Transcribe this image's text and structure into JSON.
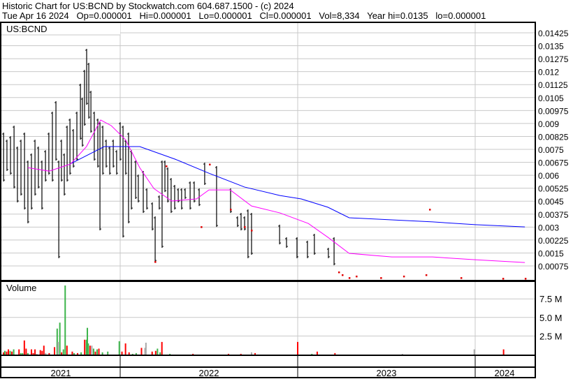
{
  "header": {
    "line1": "Historic Chart for US:BCND by Stockwatch.com 604.687.1500 - (c) 2024",
    "line2": "Tue Apr 16 2024   Op=0.000001   Hi=0.000001   Lo=0.000001   Cl=0.000001   Vol=8,334   Year hi=0.0135   lo=0.000001"
  },
  "chart_data": [
    {
      "type": "line",
      "title": "US:BCND",
      "x_unit": "year",
      "xlim": [
        2021.33,
        2024.335
      ],
      "ylim": [
        0,
        0.0148
      ],
      "yticks": [
        "0.01425",
        "0.0135",
        "0.01275",
        "0.012",
        "0.01125",
        "0.0105",
        "0.00975",
        "0.009",
        "0.00825",
        "0.0075",
        "0.00675",
        "0.006",
        "0.00525",
        "0.0045",
        "0.00375",
        "0.003",
        "0.00225",
        "0.0015",
        "0.00075"
      ],
      "price_bars_hi_lo": [
        [
          2021.343,
          0.00847,
          0.00564
        ],
        [
          2021.362,
          0.00806,
          0.00625
        ],
        [
          2021.382,
          0.00826,
          0.00604
        ],
        [
          2021.402,
          0.00887,
          0.00524
        ],
        [
          2021.421,
          0.00766,
          0.00443
        ],
        [
          2021.441,
          0.00806,
          0.00483
        ],
        [
          2021.461,
          0.00847,
          0.00402
        ],
        [
          2021.48,
          0.00685,
          0.00322
        ],
        [
          2021.5,
          0.00726,
          0.00402
        ],
        [
          2021.52,
          0.00806,
          0.00483
        ],
        [
          2021.539,
          0.00766,
          0.00524
        ],
        [
          2021.559,
          0.00685,
          0.00402
        ],
        [
          2021.579,
          0.00745,
          0.00564
        ],
        [
          2021.598,
          0.00847,
          0.00604
        ],
        [
          2021.618,
          0.00968,
          0.00564
        ],
        [
          2021.638,
          0.01029,
          0.00685
        ],
        [
          2021.654,
          0.00685,
          0.0012
        ],
        [
          2021.669,
          0.00806,
          0.00564
        ],
        [
          2021.685,
          0.00726,
          0.00483
        ],
        [
          2021.701,
          0.00887,
          0.00564
        ],
        [
          2021.717,
          0.00928,
          0.00604
        ],
        [
          2021.736,
          0.00867,
          0.00645
        ],
        [
          2021.756,
          0.00968,
          0.00685
        ],
        [
          2021.776,
          0.0113,
          0.00806
        ],
        [
          2021.787,
          0.01049,
          0.00766
        ],
        [
          2021.799,
          0.0121,
          0.00887
        ],
        [
          2021.811,
          0.01332,
          0.01008
        ],
        [
          2021.823,
          0.01251,
          0.00928
        ],
        [
          2021.835,
          0.01089,
          0.00847
        ],
        [
          2021.854,
          0.00968,
          0.00685
        ],
        [
          2021.874,
          0.00928,
          0.00645
        ],
        [
          2021.886,
          0.00907,
          0.00281
        ],
        [
          2021.902,
          0.00887,
          0.00604
        ],
        [
          2021.921,
          0.00806,
          0.00645
        ],
        [
          2021.941,
          0.00766,
          0.00604
        ],
        [
          2021.961,
          0.00806,
          0.00645
        ],
        [
          2021.98,
          0.00745,
          0.00604
        ],
        [
          2022.0,
          0.00907,
          0.00685
        ],
        [
          2022.016,
          0.00887,
          0.0024
        ],
        [
          2022.031,
          0.00806,
          0.00604
        ],
        [
          2022.047,
          0.00847,
          0.00322
        ],
        [
          2022.063,
          0.00745,
          0.00402
        ],
        [
          2022.087,
          0.00685,
          0.00463
        ],
        [
          2022.102,
          0.00604,
          0.00443
        ],
        [
          2022.13,
          0.00625,
          0.00382
        ],
        [
          2022.15,
          0.00524,
          0.00402
        ],
        [
          2022.181,
          0.00443,
          0.00281
        ],
        [
          2022.197,
          0.00362,
          0.00099
        ],
        [
          2022.22,
          0.00483,
          0.00402
        ],
        [
          2022.236,
          0.00685,
          0.0018
        ],
        [
          2022.252,
          0.00685,
          0.00503
        ],
        [
          2022.268,
          0.00645,
          0.00443
        ],
        [
          2022.287,
          0.00584,
          0.00382
        ],
        [
          2022.307,
          0.00544,
          0.00402
        ],
        [
          2022.327,
          0.00524,
          0.00443
        ],
        [
          2022.346,
          0.00524,
          0.00402
        ],
        [
          2022.366,
          0.00524,
          0.00463
        ],
        [
          2022.394,
          0.00564,
          0.00402
        ],
        [
          2022.417,
          0.00564,
          0.00443
        ],
        [
          2022.445,
          0.00524,
          0.00422
        ],
        [
          2022.476,
          0.00673,
          0.00544
        ],
        [
          2022.543,
          0.00653,
          0.00301
        ],
        [
          2022.622,
          0.00524,
          0.00382
        ],
        [
          2022.661,
          0.00362,
          0.00301
        ],
        [
          2022.681,
          0.00382,
          0.00281
        ],
        [
          2022.701,
          0.00362,
          0.00281
        ],
        [
          2022.72,
          0.00402,
          0.0012
        ],
        [
          2022.74,
          0.00382,
          0.0014
        ],
        [
          2022.898,
          0.00314,
          0.002
        ],
        [
          2022.937,
          0.00241,
          0.0018
        ],
        [
          2022.996,
          0.00241,
          0.0012
        ],
        [
          2023.055,
          0.00221,
          0.0012
        ],
        [
          2023.094,
          0.00261,
          0.0014
        ],
        [
          2023.173,
          0.0018,
          0.0012
        ],
        [
          2023.205,
          0.00241,
          0.00079
        ]
      ],
      "red_dots": [
        [
          2022.504,
          0.00663
        ],
        [
          2022.622,
          0.00402
        ],
        [
          2022.457,
          0.00301
        ],
        [
          2022.26,
          0.00653
        ],
        [
          2022.197,
          0.00099
        ],
        [
          2022.701,
          0.00301
        ],
        [
          2022.74,
          0.00281
        ],
        [
          2023.744,
          0.00402
        ],
        [
          2023.232,
          0.00039
        ],
        [
          2023.252,
          0.00023
        ],
        [
          2023.291,
          6e-05
        ],
        [
          2023.331,
          0.00015
        ],
        [
          2023.469,
          6e-05
        ],
        [
          2023.598,
          0.00015
        ],
        [
          2023.724,
          0.00023
        ],
        [
          2023.921,
          6e-05
        ],
        [
          2024.157,
          2e-05
        ],
        [
          2024.283,
          2e-05
        ]
      ],
      "series": [
        {
          "name": "long moving average",
          "color": "#0000ff",
          "points": [
            [
              2021.717,
              0.00665
            ],
            [
              2021.91,
              0.00766
            ],
            [
              2022.11,
              0.00766
            ],
            [
              2022.31,
              0.00693
            ],
            [
              2022.5,
              0.00612
            ],
            [
              2022.7,
              0.00532
            ],
            [
              2022.9,
              0.00483
            ],
            [
              2023.02,
              0.00463
            ],
            [
              2023.17,
              0.00415
            ],
            [
              2023.29,
              0.00354
            ],
            [
              2023.53,
              0.00342
            ],
            [
              2023.76,
              0.0033
            ],
            [
              2024.0,
              0.00314
            ],
            [
              2024.28,
              0.00301
            ]
          ]
        },
        {
          "name": "short moving average",
          "color": "#ff00ff",
          "points": [
            [
              2021.48,
              0.00644
            ],
            [
              2021.6,
              0.00624
            ],
            [
              2021.72,
              0.00665
            ],
            [
              2021.81,
              0.00766
            ],
            [
              2021.89,
              0.0092
            ],
            [
              2021.95,
              0.00887
            ],
            [
              2022.03,
              0.00806
            ],
            [
              2022.11,
              0.00644
            ],
            [
              2022.19,
              0.00523
            ],
            [
              2022.29,
              0.00451
            ],
            [
              2022.43,
              0.00463
            ],
            [
              2022.5,
              0.00515
            ],
            [
              2022.62,
              0.00515
            ],
            [
              2022.74,
              0.00422
            ],
            [
              2022.9,
              0.00382
            ],
            [
              2023.06,
              0.00321
            ],
            [
              2023.17,
              0.00241
            ],
            [
              2023.29,
              0.00148
            ],
            [
              2023.53,
              0.00127
            ],
            [
              2023.76,
              0.00127
            ],
            [
              2024.0,
              0.00111
            ],
            [
              2024.28,
              0.00095
            ]
          ]
        }
      ]
    },
    {
      "type": "bar",
      "title": "Volume",
      "ylim": [
        0,
        10
      ],
      "yunit": "M",
      "yticks": [
        "2.5 M",
        "5.0 M",
        "7.5 M"
      ],
      "bars": [
        [
          2021.343,
          0.3,
          "r"
        ],
        [
          2021.35,
          0.5,
          "g"
        ],
        [
          2021.36,
          0.4,
          "r"
        ],
        [
          2021.37,
          0.7,
          "r"
        ],
        [
          2021.38,
          0.5,
          "g"
        ],
        [
          2021.39,
          0.4,
          "r"
        ],
        [
          2021.4,
          0.7,
          "g"
        ],
        [
          2021.43,
          0.7,
          "r"
        ],
        [
          2021.44,
          0.2,
          "g"
        ],
        [
          2021.45,
          0.2,
          "g"
        ],
        [
          2021.46,
          1.9,
          "r"
        ],
        [
          2021.47,
          0.8,
          "r"
        ],
        [
          2021.48,
          0.2,
          "g"
        ],
        [
          2021.5,
          0.7,
          "r"
        ],
        [
          2021.51,
          0.2,
          "r"
        ],
        [
          2021.52,
          0.7,
          "r"
        ],
        [
          2021.53,
          0.1,
          "x"
        ],
        [
          2021.55,
          0.6,
          "r"
        ],
        [
          2021.56,
          0.5,
          "r"
        ],
        [
          2021.57,
          1.2,
          "r"
        ],
        [
          2021.58,
          0.2,
          "x"
        ],
        [
          2021.6,
          0.2,
          "r"
        ],
        [
          2021.63,
          1.0,
          "r"
        ],
        [
          2021.645,
          3.5,
          "g"
        ],
        [
          2021.65,
          1.7,
          "x"
        ],
        [
          2021.66,
          4.3,
          "g"
        ],
        [
          2021.67,
          0.3,
          "r"
        ],
        [
          2021.68,
          0.7,
          "g"
        ],
        [
          2021.69,
          9.3,
          "g"
        ],
        [
          2021.7,
          1.2,
          "r"
        ],
        [
          2021.73,
          0.4,
          "r"
        ],
        [
          2021.74,
          0.2,
          "g"
        ],
        [
          2021.76,
          0.2,
          "r"
        ],
        [
          2021.78,
          0.3,
          "g"
        ],
        [
          2021.8,
          2.0,
          "r"
        ],
        [
          2021.81,
          2.0,
          "g"
        ],
        [
          2021.815,
          3.6,
          "g"
        ],
        [
          2021.82,
          1.5,
          "g"
        ],
        [
          2021.83,
          1.2,
          "r"
        ],
        [
          2021.84,
          1.2,
          "x"
        ],
        [
          2021.85,
          0.8,
          "g"
        ],
        [
          2021.86,
          0.4,
          "r"
        ],
        [
          2021.87,
          0.7,
          "g"
        ],
        [
          2021.88,
          0.8,
          "r"
        ],
        [
          2021.9,
          0.3,
          "g"
        ],
        [
          2021.93,
          0.4,
          "g"
        ],
        [
          2021.995,
          1.8,
          "g"
        ],
        [
          2022.01,
          0.4,
          "r"
        ],
        [
          2022.03,
          1.5,
          "r"
        ],
        [
          2022.05,
          0.3,
          "r"
        ],
        [
          2022.07,
          0.1,
          "g"
        ],
        [
          2022.09,
          0.2,
          "g"
        ],
        [
          2022.12,
          0.9,
          "r"
        ],
        [
          2022.14,
          0.9,
          "x"
        ],
        [
          2022.145,
          1.6,
          "x"
        ],
        [
          2022.18,
          0.4,
          "r"
        ],
        [
          2022.2,
          0.5,
          "r"
        ],
        [
          2022.21,
          0.8,
          "g"
        ],
        [
          2022.225,
          0.3,
          "g"
        ],
        [
          2022.235,
          1.7,
          "r"
        ],
        [
          2022.28,
          0.1,
          "g"
        ],
        [
          2022.41,
          0.1,
          "r"
        ],
        [
          2022.61,
          0.1,
          "r"
        ],
        [
          2022.68,
          0.1,
          "r"
        ],
        [
          2022.74,
          0.3,
          "x"
        ],
        [
          2022.76,
          0.2,
          "r"
        ],
        [
          2023.0,
          1.7,
          "r"
        ],
        [
          2023.08,
          0.1,
          "g"
        ],
        [
          2023.11,
          0.4,
          "r"
        ],
        [
          2023.21,
          0.2,
          "r"
        ],
        [
          2023.59,
          0.1,
          "x"
        ],
        [
          2023.995,
          0.7,
          "x"
        ],
        [
          2024.16,
          0.7,
          "r"
        ]
      ]
    },
    {
      "type": "axis",
      "x_labels": [
        "2021",
        "2022",
        "2023",
        "2024"
      ]
    }
  ]
}
